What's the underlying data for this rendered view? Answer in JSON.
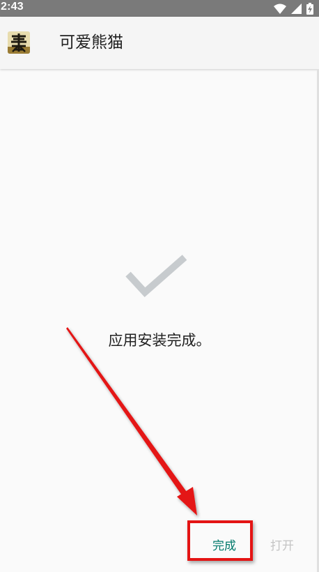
{
  "status_bar": {
    "time": "2:43",
    "icons": [
      "wifi-icon",
      "signal-icon",
      "battery-charging-icon"
    ]
  },
  "app_bar": {
    "icon": "app-logo-icon",
    "title": "可爱熊猫"
  },
  "content": {
    "icon": "checkmark-icon",
    "message": "应用安装完成。"
  },
  "buttons": {
    "done_label": "完成",
    "open_label": "打开"
  },
  "colors": {
    "status_bar": "#7a7a7a",
    "accent": "#00796b",
    "disabled": "#c4c4c4",
    "check": "#c7cbce",
    "annotation": "#e41414"
  }
}
